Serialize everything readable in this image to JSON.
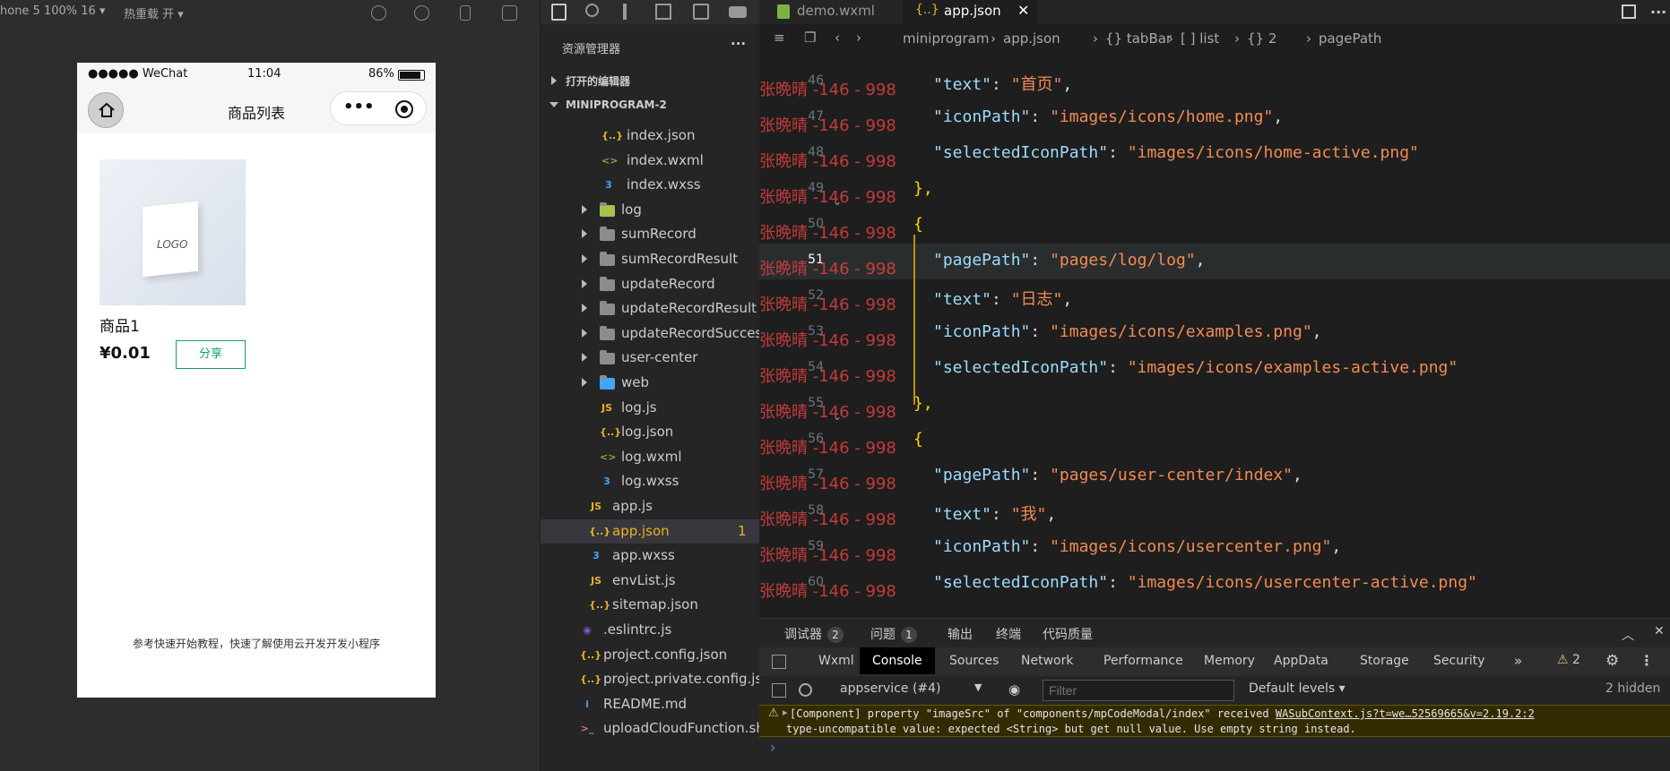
{
  "simulator": {
    "device_label": "hone 5 100% 16 ▾",
    "hot_reload": "热重载 开 ▾",
    "status": {
      "carrier": "●●●●● WeChat",
      "time": "11:04",
      "battery": "86%"
    },
    "nav_title": "商品列表",
    "capsule_more": "•••",
    "product": {
      "name": "商品1",
      "price": "¥0.01",
      "share": "分享",
      "image_logo": "LOGO"
    },
    "footer": "参考快速开始教程，快速了解使用云开发开发小程序"
  },
  "explorer": {
    "title": "资源管理器",
    "more": "···",
    "open_editors": "打开的编辑器",
    "project": "MINIPROGRAM-2",
    "items": [
      {
        "label": "index.json",
        "icon": "json-icon",
        "type": "file",
        "glyph": "{..}",
        "color": "#e6b422"
      },
      {
        "label": "index.wxml",
        "icon": "wxml-icon",
        "type": "file",
        "glyph": "<>",
        "color": "#7cb342"
      },
      {
        "label": "index.wxss",
        "icon": "wxss-icon",
        "type": "file",
        "glyph": "3",
        "color": "#42a5f5"
      },
      {
        "label": "log",
        "icon": "folder-icon",
        "type": "folder",
        "glyph": "",
        "color": "#a5c34b"
      },
      {
        "label": "sumRecord",
        "icon": "folder-icon",
        "type": "folder",
        "glyph": "",
        "color": "#8c8c8c"
      },
      {
        "label": "sumRecordResult",
        "icon": "folder-icon",
        "type": "folder",
        "glyph": "",
        "color": "#8c8c8c"
      },
      {
        "label": "updateRecord",
        "icon": "folder-icon",
        "type": "folder",
        "glyph": "",
        "color": "#8c8c8c"
      },
      {
        "label": "updateRecordResult",
        "icon": "folder-icon",
        "type": "folder",
        "glyph": "",
        "color": "#8c8c8c"
      },
      {
        "label": "updateRecordSuccess",
        "icon": "folder-icon",
        "type": "folder",
        "glyph": "",
        "color": "#8c8c8c"
      },
      {
        "label": "user-center",
        "icon": "folder-icon",
        "type": "folder",
        "glyph": "",
        "color": "#8c8c8c"
      },
      {
        "label": "web",
        "icon": "folder-icon",
        "type": "folder",
        "glyph": "",
        "color": "#42a5f5"
      },
      {
        "label": "log.js",
        "icon": "js-icon",
        "type": "file",
        "glyph": "JS",
        "color": "#e6b422"
      },
      {
        "label": "log.json",
        "icon": "json-icon",
        "type": "file",
        "glyph": "{..}",
        "color": "#e6b422"
      },
      {
        "label": "log.wxml",
        "icon": "wxml-icon",
        "type": "file",
        "glyph": "<>",
        "color": "#7cb342"
      },
      {
        "label": "log.wxss",
        "icon": "wxss-icon",
        "type": "file",
        "glyph": "3",
        "color": "#42a5f5"
      },
      {
        "label": "app.js",
        "icon": "js-icon",
        "type": "file",
        "glyph": "JS",
        "color": "#e6b422"
      },
      {
        "label": "app.json",
        "icon": "json-icon",
        "type": "file",
        "glyph": "{..}",
        "color": "#e6b422",
        "badge": "1"
      },
      {
        "label": "app.wxss",
        "icon": "wxss-icon",
        "type": "file",
        "glyph": "3",
        "color": "#42a5f5"
      },
      {
        "label": "envList.js",
        "icon": "js-icon",
        "type": "file",
        "glyph": "JS",
        "color": "#e6b422"
      },
      {
        "label": "sitemap.json",
        "icon": "json-icon",
        "type": "file",
        "glyph": "{..}",
        "color": "#e6b422"
      },
      {
        "label": ".eslintrc.js",
        "icon": "eslint-icon",
        "type": "file",
        "glyph": "◉",
        "color": "#7e57c2"
      },
      {
        "label": "project.config.json",
        "icon": "json-icon",
        "type": "file",
        "glyph": "{..}",
        "color": "#e6b422"
      },
      {
        "label": "project.private.config.js...",
        "icon": "json-icon",
        "type": "file",
        "glyph": "{..}",
        "color": "#e6b422"
      },
      {
        "label": "README.md",
        "icon": "info-icon",
        "type": "file",
        "glyph": "i",
        "color": "#42a5f5"
      },
      {
        "label": "uploadCloudFunction.sh",
        "icon": "shell-icon",
        "type": "file",
        "glyph": ">_",
        "color": "#e57373"
      }
    ]
  },
  "editor": {
    "tabs": [
      {
        "label": "demo.wxml"
      },
      {
        "label": "app.json",
        "active": true
      }
    ],
    "breadcrumb": [
      "miniprogram",
      "app.json",
      "{} tabBar",
      "[ ] list",
      "{} 2",
      "pagePath"
    ],
    "watermark": "张晩晴 -146 - 998",
    "lines": [
      {
        "n": "46",
        "parts": [
          [
            "key",
            "\"text\""
          ],
          [
            "pun",
            ": "
          ],
          [
            "str",
            "\"首页\""
          ],
          [
            "pun",
            ","
          ]
        ]
      },
      {
        "n": "47",
        "parts": [
          [
            "key",
            "\"iconPath\""
          ],
          [
            "pun",
            ": "
          ],
          [
            "str",
            "\"images/icons/home.png\""
          ],
          [
            "pun",
            ","
          ]
        ]
      },
      {
        "n": "48",
        "parts": [
          [
            "key",
            "\"selectedIconPath\""
          ],
          [
            "pun",
            ": "
          ],
          [
            "str",
            "\"images/icons/home-active.png\""
          ]
        ]
      },
      {
        "n": "49",
        "parts": [
          [
            "brk",
            "},"
          ]
        ]
      },
      {
        "n": "50",
        "parts": [
          [
            "brk",
            "{"
          ]
        ]
      },
      {
        "n": "51",
        "parts": [
          [
            "key",
            "\"pagePath\""
          ],
          [
            "pun",
            ": "
          ],
          [
            "str",
            "\"pages/log/log\""
          ],
          [
            "pun",
            ","
          ]
        ]
      },
      {
        "n": "52",
        "parts": [
          [
            "key",
            "\"text\""
          ],
          [
            "pun",
            ": "
          ],
          [
            "str",
            "\"日志\""
          ],
          [
            "pun",
            ","
          ]
        ]
      },
      {
        "n": "53",
        "parts": [
          [
            "key",
            "\"iconPath\""
          ],
          [
            "pun",
            ": "
          ],
          [
            "str",
            "\"images/icons/examples.png\""
          ],
          [
            "pun",
            ","
          ]
        ]
      },
      {
        "n": "54",
        "parts": [
          [
            "key",
            "\"selectedIconPath\""
          ],
          [
            "pun",
            ": "
          ],
          [
            "str",
            "\"images/icons/examples-active.png\""
          ]
        ]
      },
      {
        "n": "55",
        "parts": [
          [
            "brk",
            "},"
          ]
        ]
      },
      {
        "n": "56",
        "parts": [
          [
            "brk",
            "{"
          ]
        ]
      },
      {
        "n": "57",
        "parts": [
          [
            "key",
            "\"pagePath\""
          ],
          [
            "pun",
            ": "
          ],
          [
            "str",
            "\"pages/user-center/index\""
          ],
          [
            "pun",
            ","
          ]
        ]
      },
      {
        "n": "58",
        "parts": [
          [
            "key",
            "\"text\""
          ],
          [
            "pun",
            ": "
          ],
          [
            "str",
            "\"我\""
          ],
          [
            "pun",
            ","
          ]
        ]
      },
      {
        "n": "59",
        "parts": [
          [
            "key",
            "\"iconPath\""
          ],
          [
            "pun",
            ": "
          ],
          [
            "str",
            "\"images/icons/usercenter.png\""
          ],
          [
            "pun",
            ","
          ]
        ]
      },
      {
        "n": "60",
        "parts": [
          [
            "key",
            "\"selectedIconPath\""
          ],
          [
            "pun",
            ": "
          ],
          [
            "str",
            "\"images/icons/usercenter-active.png\""
          ]
        ]
      }
    ]
  },
  "devtools": {
    "top_tabs": [
      {
        "label": "调试器",
        "badge": "2"
      },
      {
        "label": "问题",
        "badge": "1"
      },
      {
        "label": "输出"
      },
      {
        "label": "终端"
      },
      {
        "label": "代码质量"
      }
    ],
    "panel_tabs": [
      "Wxml",
      "Console",
      "Sources",
      "Network",
      "Performance",
      "Memory",
      "AppData",
      "Storage",
      "Security"
    ],
    "active_panel": "Console",
    "warning_count": "2",
    "context": "appservice (#4)",
    "filter_placeholder": "Filter",
    "levels": "Default levels ▾",
    "hidden": "2 hidden",
    "message_line1": "[Component] property \"imageSrc\" of \"components/mpCodeModal/index\" received ",
    "message_link": "WASubContext.js?t=we…52569665&v=2.19.2:2",
    "message_line2": "type-uncompatible value: expected <String> but get null value. Use empty string instead.",
    "prompt": "›"
  },
  "colors": {
    "accent": "#19a15f",
    "warn": "#e5c07b",
    "key": "#9cdcfe",
    "string": "#f28b54"
  }
}
